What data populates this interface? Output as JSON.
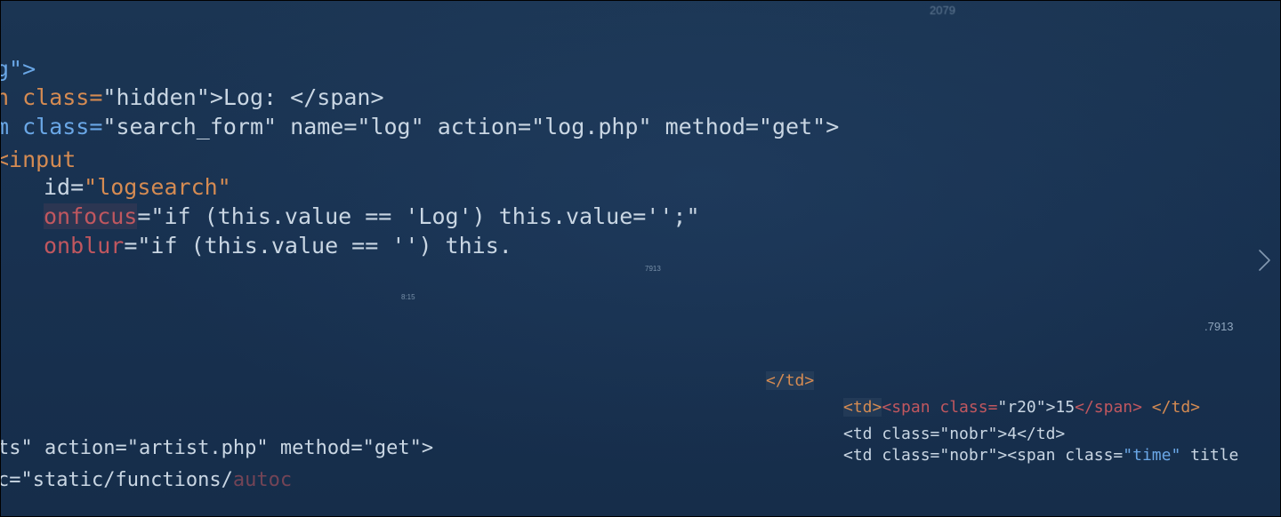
{
  "code_top": {
    "line1": "g\">",
    "line2_a": "n class=",
    "line2_b": "\"hidden\">Log: </span>",
    "line3_a": "m class=",
    "line3_b": "\"search_form\" name=\"log\" action=\"log.php\" method=\"get\">",
    "line4": "<input",
    "line5_a": "id=",
    "line5_b": "\"logsearch\"",
    "line6_a": "onfocus",
    "line6_b": "=\"if (this.value == 'Log') this.value='';\"",
    "line7_a": "onblur",
    "line7_b": "=\"if (this.value == '') this."
  },
  "code_bottom_left": {
    "line8": "ts\" action=\"artist.php\" method=\"get\">",
    "line9_a": "c=\"static/functions/",
    "line9_b": "autoc"
  },
  "code_right": {
    "line10": "</td>",
    "line11_a": "<td>",
    "line11_b": "<span class=",
    "line11_c": "\"r20\">15",
    "line11_d": "</span>",
    "line11_e": " </td>",
    "line12": "<td class=\"nobr\">4</td>",
    "line13_a": "<td class=\"nobr\"><span class=",
    "line13_b": "\"time\"",
    "line13_c": " title"
  },
  "tiny_labels": {
    "top": "2079",
    "mid": "7913",
    "small": "8:15",
    "right": ".7913"
  },
  "controls": {
    "next_icon": "chevron-right-icon"
  },
  "colors": {
    "background": "#183150",
    "tag_blue": "#6aa7e6",
    "string": "#c9d6e3",
    "orange": "#d58b52",
    "red": "#c0575f"
  }
}
